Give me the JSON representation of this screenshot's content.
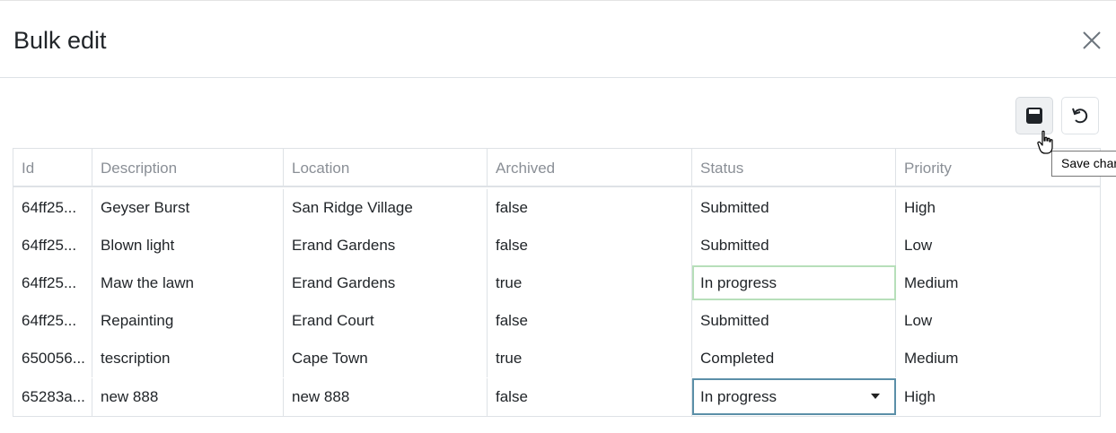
{
  "modal": {
    "title": "Bulk edit"
  },
  "toolbar": {
    "save_icon": "save-icon",
    "undo_icon": "undo-icon",
    "tooltip": "Save char"
  },
  "grid": {
    "columns": [
      "Id",
      "Description",
      "Location",
      "Archived",
      "Status",
      "Priority"
    ],
    "rows": [
      {
        "id": "64ff25...",
        "description": "Geyser Burst",
        "location": "San Ridge Village",
        "archived": "false",
        "status": "Submitted",
        "priority": "High"
      },
      {
        "id": "64ff25...",
        "description": "Blown light",
        "location": "Erand Gardens",
        "archived": "false",
        "status": "Submitted",
        "priority": "Low"
      },
      {
        "id": "64ff25...",
        "description": "Maw the lawn",
        "location": "Erand Gardens",
        "archived": "true",
        "status": "In progress",
        "priority": "Medium"
      },
      {
        "id": "64ff25...",
        "description": "Repainting",
        "location": "Erand Court",
        "archived": "false",
        "status": "Submitted",
        "priority": "Low"
      },
      {
        "id": "650056...",
        "description": "tescription",
        "location": "Cape Town",
        "archived": "true",
        "status": "Completed",
        "priority": "Medium"
      },
      {
        "id": "65283a...",
        "description": "new 888",
        "location": "new 888",
        "archived": "false",
        "status": "In progress",
        "priority": "High"
      }
    ]
  },
  "colors": {
    "edited_cell_border": "#b7dfba",
    "active_editor_border": "#5b8fa8",
    "header_text": "#8a8f96"
  }
}
